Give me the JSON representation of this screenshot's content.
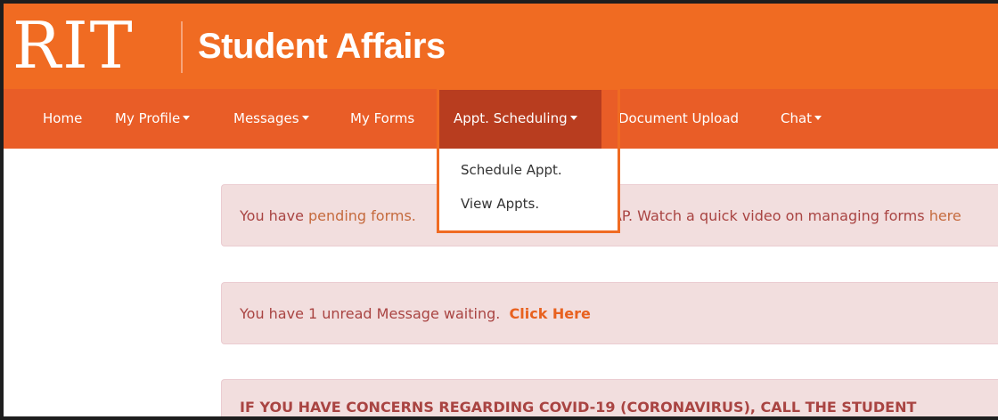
{
  "brand": {
    "logo_text": "RIT",
    "title": "Student Affairs",
    "bar_color": "#f06b22"
  },
  "nav": {
    "home": "Home",
    "my_profile": "My Profile",
    "messages": "Messages",
    "my_forms": "My Forms",
    "appt_scheduling": "Appt. Scheduling",
    "document_upload": "Document Upload",
    "chat": "Chat",
    "bar_color": "#e95d27",
    "active_color": "#b83d1f"
  },
  "dropdown": {
    "items": [
      "Schedule Appt.",
      "View Appts."
    ]
  },
  "alerts": {
    "a1_prefix": "You have ",
    "a1_link": "pending forms.",
    "a1_middle": "AP. Watch a quick video on managing forms ",
    "a1_link2": "here",
    "a2_text": "You have 1 unread Message waiting.",
    "a2_link": "Click Here",
    "a3_text": "IF YOU HAVE CONCERNS REGARDING COVID-19 (CORONAVIRUS), CALL THE STUDENT"
  }
}
